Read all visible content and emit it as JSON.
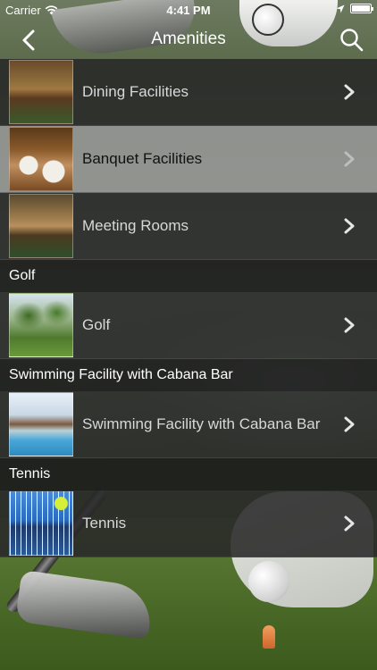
{
  "status_bar": {
    "carrier": "Carrier",
    "time": "4:41 PM"
  },
  "nav": {
    "title": "Amenities",
    "back_icon": "chevron-left-icon",
    "search_icon": "search-icon"
  },
  "list": {
    "group_main": [
      {
        "label": "Dining Facilities",
        "thumb": "dining-room-photo"
      },
      {
        "label": "Banquet Facilities",
        "thumb": "banquet-hall-photo",
        "selected": true
      },
      {
        "label": "Meeting Rooms",
        "thumb": "meeting-room-photo"
      }
    ],
    "sections": [
      {
        "header": "Golf",
        "items": [
          {
            "label": "Golf",
            "thumb": "golf-course-photo"
          }
        ]
      },
      {
        "header": "Swimming Facility with Cabana Bar",
        "items": [
          {
            "label": "Swimming Facility with Cabana Bar",
            "thumb": "pool-photo"
          }
        ]
      },
      {
        "header": "Tennis",
        "items": [
          {
            "label": "Tennis",
            "thumb": "tennis-net-photo"
          }
        ]
      }
    ]
  },
  "colors": {
    "row_bg": "#282828",
    "row_selected_bg": "#969696",
    "section_bg": "#191919",
    "text": "#d8d8d8"
  }
}
